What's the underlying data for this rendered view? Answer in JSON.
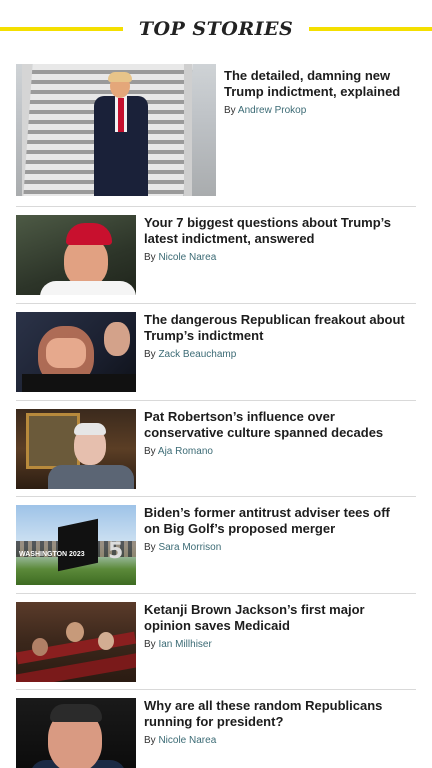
{
  "section": {
    "title": "TOP STORIES",
    "accent_color": "#f4df00"
  },
  "lead": {
    "headline": "The detailed, damning new Trump indictment, explained",
    "by_prefix": "By",
    "author": "Andrew Prokop"
  },
  "stories": [
    {
      "headline": "Your 7 biggest questions about Trump’s latest indictment, answered",
      "by_prefix": "By",
      "author": "Nicole Narea"
    },
    {
      "headline": "The dangerous Republican freakout about Trump’s indictment",
      "by_prefix": "By",
      "author": "Zack Beauchamp"
    },
    {
      "headline": "Pat Robertson’s influence over conservative culture spanned decades",
      "by_prefix": "By",
      "author": "Aja Romano"
    },
    {
      "headline": "Biden’s former antitrust adviser tees off on Big Golf’s proposed merger",
      "by_prefix": "By",
      "author": "Sara Morrison",
      "image_text": "WASHINGTON 2023",
      "image_number": "5"
    },
    {
      "headline": "Ketanji Brown Jackson’s first major opinion saves Medicaid",
      "by_prefix": "By",
      "author": "Ian Millhiser"
    },
    {
      "headline": "Why are all these random Republicans running for president?",
      "by_prefix": "By",
      "author": "Nicole Narea"
    }
  ],
  "author_link_color": "#3c6b75"
}
